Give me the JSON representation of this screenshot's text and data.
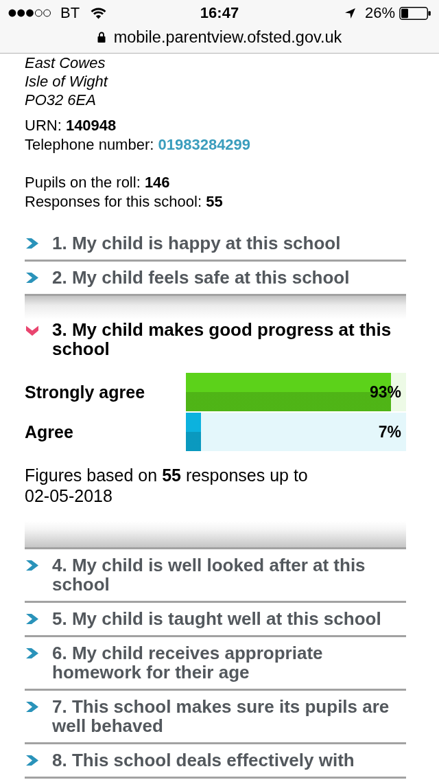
{
  "status_bar": {
    "carrier": "BT",
    "time": "16:47",
    "battery": "26%"
  },
  "address_bar": {
    "url": "mobile.parentview.ofsted.gov.uk"
  },
  "school": {
    "address_lines": [
      "East Cowes",
      "Isle of Wight",
      "PO32 6EA"
    ],
    "urn": "URN: **140948**",
    "telephone": {
      "label": "Telephone number:",
      "number": "01983284299"
    },
    "pupils": "Pupils on the roll: **146**",
    "responses": "Responses for this school: **55**"
  },
  "questions": [
    {
      "label": "1. My child is happy at this school",
      "expanded": false
    },
    {
      "label": "2. My child feels safe at this school",
      "expanded": false
    },
    {
      "label": "3. My child makes good progress at this school",
      "expanded": true,
      "results": [
        {
          "answer": "Strongly agree",
          "level": 0.93,
          "reading": "93%",
          "color": "#5cd21a"
        },
        {
          "answer": "Agree",
          "level": 0.07,
          "reading": "7%",
          "color": "#0cb2de"
        }
      ],
      "footnote": "Figures based on **55** responses up to 02-05-2018"
    },
    {
      "label": "4. My child is well looked after at this school",
      "expanded": false
    },
    {
      "label": "5. My child is taught well at this school",
      "expanded": false
    },
    {
      "label": "6. My child receives appropriate homework for their age",
      "expanded": false
    },
    {
      "label": "7. This school makes sure its pupils are well behaved",
      "expanded": false
    },
    {
      "label": "8. This school deals effectively with",
      "expanded": false
    }
  ]
}
